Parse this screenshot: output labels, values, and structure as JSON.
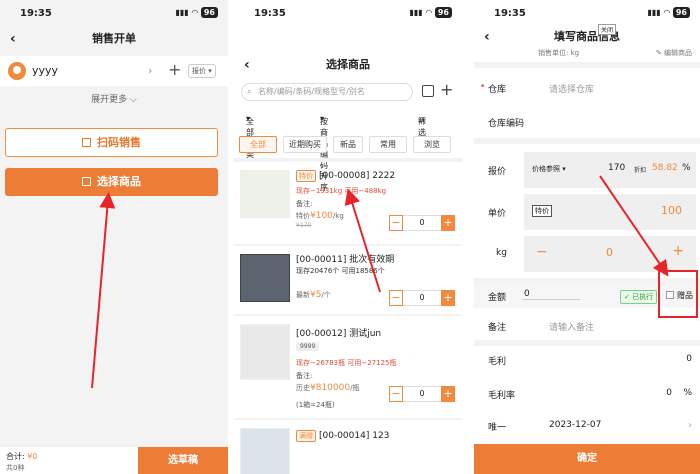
{
  "status_bar": {
    "time": "19:35",
    "battery": "96"
  },
  "screen1": {
    "title": "销售开单",
    "back": "‹",
    "customer_name": "yyyy",
    "price_label": "报价",
    "expand_more": "展开更多",
    "scan_sale": "扫码销售",
    "select_goods": "选择商品",
    "total_label": "合计:",
    "total_value": "¥0",
    "total_sub": "共0种",
    "draft_button": "选草稿"
  },
  "screen2": {
    "title": "选择商品",
    "search_placeholder": "名称/编码/条码/规格型号/别名",
    "filters": {
      "all_categories": "全部分类",
      "sort": "按商品编码升序",
      "filter": "筛选"
    },
    "tabs": [
      "全部",
      "近期购买",
      "新品",
      "常用",
      "浏览"
    ],
    "products": [
      {
        "tag": "特价",
        "title": "[00-00008] 2222",
        "stock": "现存−1931kg   可用−488kg",
        "note": "备注:",
        "price_prefix": "特价",
        "price": "¥100",
        "price_unit": "/kg",
        "old_price": "¥170",
        "qty": "0"
      },
      {
        "tag": "",
        "title": "[00-00011] 批次有效期",
        "stock": "现存20476个   可用18586个",
        "note": "",
        "price_prefix": "最新",
        "price": "¥5",
        "price_unit": "/个",
        "old_price": "",
        "qty": "0"
      },
      {
        "tag": "",
        "title": "[00-00012] 测试jun",
        "chip": "9999",
        "stock": "现存−26783瓶   可用−27125瓶",
        "note": "备注:",
        "price_prefix": "历史",
        "price": "¥810000",
        "price_unit": "/瓶",
        "extra": "(1箱=24瓶)",
        "qty": "0"
      },
      {
        "tag": "满赠",
        "title": "[00-00014] 123",
        "stock": "",
        "qty": ""
      }
    ]
  },
  "screen3": {
    "title": "填写商品信息",
    "close_tip": "关闭",
    "sales_unit_label": "销售单位: kg",
    "edit_goods": "编辑商品",
    "warehouse_label": "仓库",
    "warehouse_placeholder": "请选择仓库",
    "warehouse_code_label": "仓库编码",
    "quote_label": "报价",
    "price_ref": "价格参照",
    "quote_value": "170",
    "discount_label": "折扣",
    "discount_value": "58.82",
    "percent": "%",
    "unit_price_label": "单价",
    "special_tag": "特价",
    "unit_price_value": "100",
    "kg_label": "kg",
    "qty_value": "0",
    "amount_label": "金额",
    "amount_value": "0",
    "executed": "已执行",
    "gift_label": "赠品",
    "remark_label": "备注",
    "remark_placeholder": "请输入备注",
    "gross_profit_label": "毛利",
    "gross_profit_value": "0",
    "gross_margin_label": "毛利率",
    "gross_margin_value": "0",
    "unique_label": "唯一",
    "date_value": "2023-12-07",
    "confirm": "确定"
  },
  "colors": {
    "accent": "#ec7c36",
    "annotation_red": "#e8242b",
    "success": "#2a9d3a"
  }
}
